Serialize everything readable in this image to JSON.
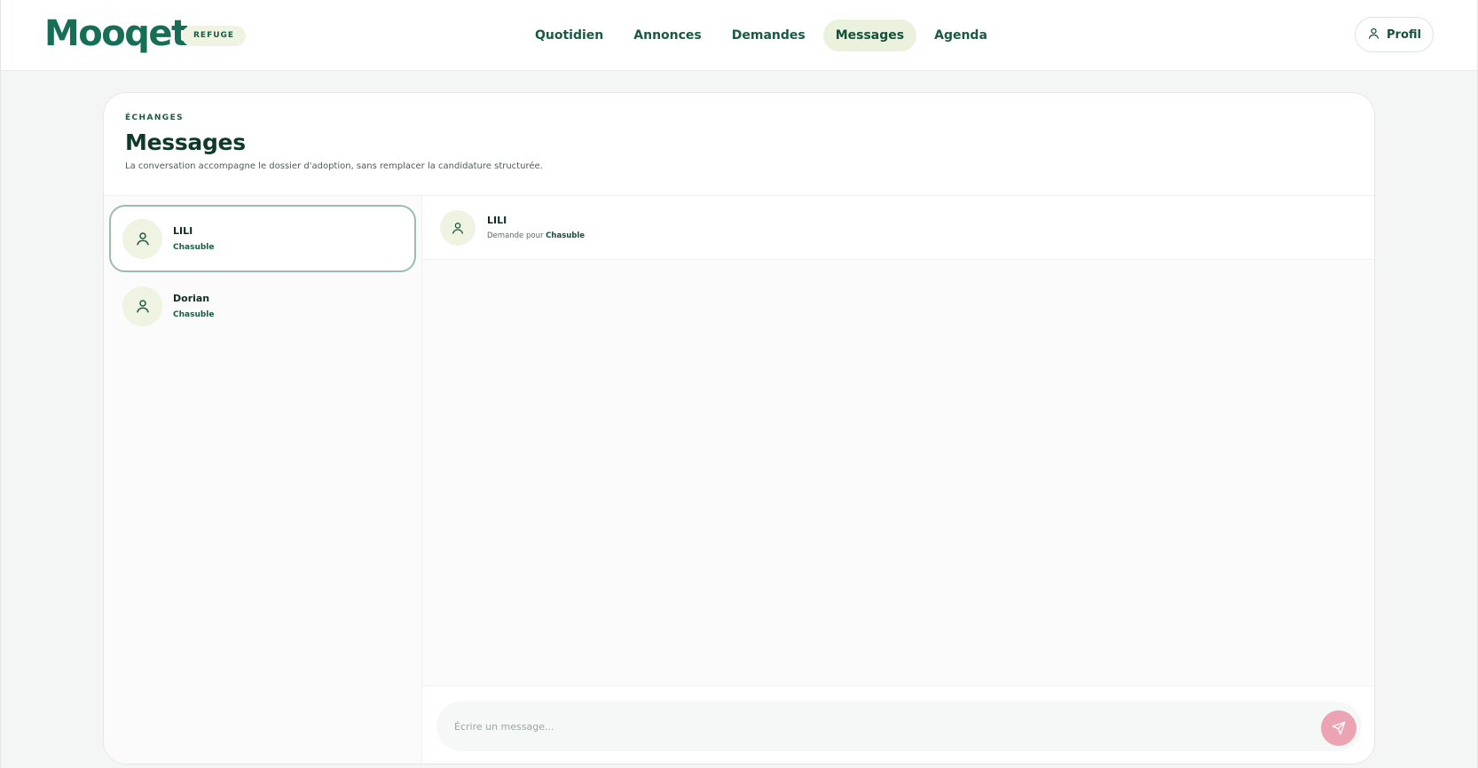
{
  "header": {
    "logo_text": "Mooqet",
    "badge": "REFUGE",
    "nav": [
      {
        "label": "Quotidien",
        "active": false
      },
      {
        "label": "Annonces",
        "active": false
      },
      {
        "label": "Demandes",
        "active": false
      },
      {
        "label": "Messages",
        "active": true
      },
      {
        "label": "Agenda",
        "active": false
      }
    ],
    "profile_label": "Profil"
  },
  "page": {
    "eyebrow": "ÉCHANGES",
    "title": "Messages",
    "subtitle": "La conversation accompagne le dossier d'adoption, sans remplacer la candidature structurée."
  },
  "conversations": [
    {
      "name": "LILI",
      "pet": "Chasuble",
      "selected": true
    },
    {
      "name": "Dorian",
      "pet": "Chasuble",
      "selected": false
    }
  ],
  "chat": {
    "name": "LILI",
    "sub_prefix": "Demande pour",
    "sub_pet": "Chasuble",
    "composer_placeholder": "Écrire un message..."
  },
  "colors": {
    "brand": "#166e56",
    "accent_light": "#eaf1dc",
    "send_button": "#eca3b3"
  }
}
